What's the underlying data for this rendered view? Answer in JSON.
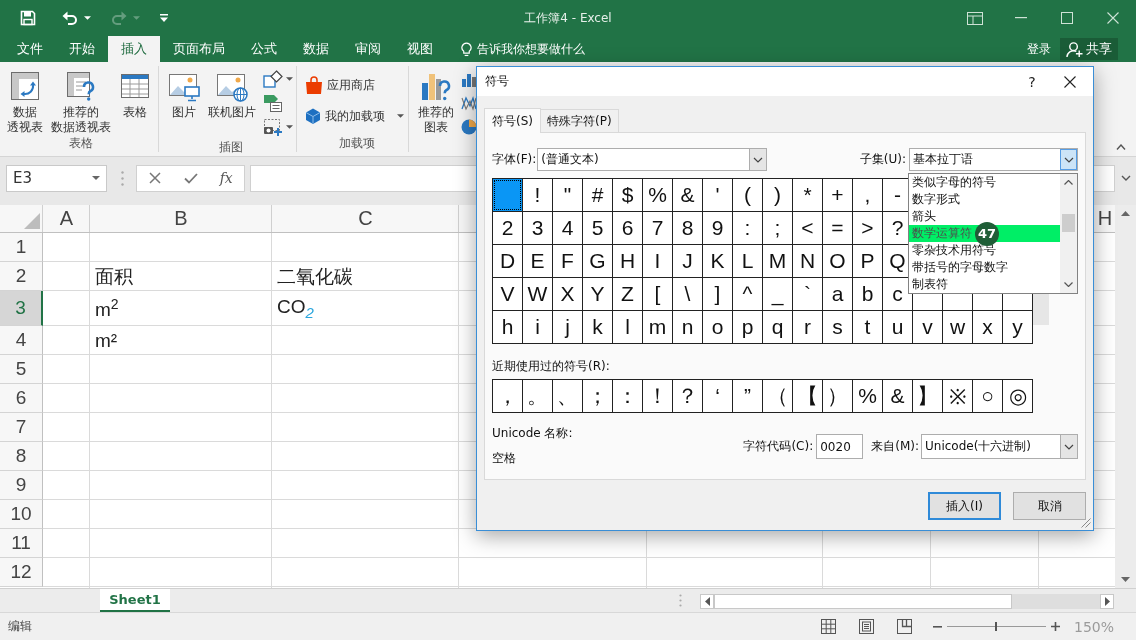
{
  "title_bar": {
    "title": "工作簿4 - Excel",
    "quick_access": [
      {
        "kind": "save",
        "disabled": false
      },
      {
        "kind": "undo",
        "disabled": false,
        "menu": true
      },
      {
        "kind": "redo",
        "disabled": true,
        "menu": true
      },
      {
        "kind": "customize",
        "disabled": false
      }
    ]
  },
  "menu": {
    "tabs": [
      {
        "label": "文件",
        "selected": false
      },
      {
        "label": "开始",
        "selected": false
      },
      {
        "label": "插入",
        "selected": true
      },
      {
        "label": "页面布局",
        "selected": false
      },
      {
        "label": "公式",
        "selected": false
      },
      {
        "label": "数据",
        "selected": false
      },
      {
        "label": "审阅",
        "selected": false
      },
      {
        "label": "视图",
        "selected": false
      }
    ],
    "tell_me": "告诉我你想要做什么",
    "sign_in": "登录",
    "share": "共享"
  },
  "ribbon": {
    "groups": [
      {
        "label": "表格",
        "large": [
          {
            "kind": "pivot_table",
            "lines": [
              "数据",
              "透视表"
            ]
          },
          {
            "kind": "recommended_pivot",
            "lines": [
              "推荐的",
              "数据透视表"
            ]
          },
          {
            "kind": "table",
            "lines": [
              "表格"
            ]
          }
        ]
      },
      {
        "label": "插图",
        "large": [
          {
            "kind": "picture",
            "lines": [
              "图片"
            ]
          },
          {
            "kind": "online_picture",
            "lines": [
              "联机图片"
            ]
          }
        ],
        "small": [
          {
            "kind": "shapes",
            "menu": true
          },
          {
            "kind": "smartart"
          },
          {
            "kind": "screenshot",
            "menu": true
          }
        ]
      },
      {
        "label": "加载项",
        "rows": [
          {
            "kind": "store",
            "label": "应用商店"
          },
          {
            "kind": "my_addins",
            "label": "我的加载项",
            "menu": true
          }
        ]
      },
      {
        "large": [
          {
            "kind": "recommended_chart",
            "lines": [
              "推荐的",
              "图表"
            ]
          }
        ],
        "small": [
          {
            "kind": "column_chart"
          },
          {
            "kind": "line_chart"
          },
          {
            "kind": "pie_chart"
          }
        ]
      }
    ]
  },
  "formula_bar": {
    "name_box": "E3",
    "function_button": "fx"
  },
  "sheet": {
    "columns": [
      "A",
      "B",
      "C",
      "H"
    ],
    "rows": [
      {
        "label": "1",
        "selected": false
      },
      {
        "label": "2",
        "selected": false,
        "column_b": "面积",
        "column_c": "二氧化碳"
      },
      {
        "label": "3",
        "selected": true,
        "column_b": "m$^{2}$",
        "column_c": "CO$_{2}$"
      },
      {
        "label": "4",
        "selected": false,
        "column_b": "m²"
      },
      {
        "label": "5",
        "selected": false
      },
      {
        "label": "6",
        "selected": false
      },
      {
        "label": "7",
        "selected": false
      },
      {
        "label": "8",
        "selected": false
      },
      {
        "label": "9",
        "selected": false
      },
      {
        "label": "10",
        "selected": false
      },
      {
        "label": "11",
        "selected": false
      },
      {
        "label": "12",
        "selected": false
      }
    ]
  },
  "sheet_tabs": [
    {
      "label": "Sheet1",
      "selected": true
    }
  ],
  "status_bar": {
    "mode": "编辑",
    "zoom": "150%",
    "zoom_slider": {
      "level": 0.5
    }
  },
  "dialog": {
    "title": "符号",
    "help": "?",
    "tabs": [
      {
        "label": "符号(S)",
        "selected": true
      },
      {
        "label": "特殊字符(P)",
        "selected": false
      }
    ],
    "font": {
      "label": "字体(F):",
      "value": "(普通文本)"
    },
    "subset": {
      "label": "子集(U):",
      "value": "基本拉丁语",
      "expanded": true,
      "options": [
        {
          "label": "类似字母的符号",
          "selected": false
        },
        {
          "label": "数字形式",
          "selected": false
        },
        {
          "label": "箭头",
          "selected": false
        },
        {
          "label": "数学运算符",
          "selected": true
        },
        {
          "label": "零杂技术用符号",
          "selected": false
        },
        {
          "label": "带括号的字母数字",
          "selected": false
        },
        {
          "label": "制表符",
          "selected": false
        }
      ]
    },
    "symbols": [
      [
        {
          "selected": true
        },
        {
          "char": "!",
          "selected": false
        },
        {
          "char": "\"",
          "selected": false
        },
        {
          "char": "#",
          "selected": false
        },
        {
          "char": "$",
          "selected": false
        },
        {
          "char": "%",
          "selected": false
        },
        {
          "char": "&",
          "selected": false
        },
        {
          "char": "'",
          "selected": false
        },
        {
          "char": "(",
          "selected": false
        },
        {
          "char": ")",
          "selected": false
        },
        {
          "char": "*",
          "selected": false
        },
        {
          "char": "+",
          "selected": false
        },
        {
          "char": ",",
          "selected": false
        },
        {
          "char": "-",
          "selected": false
        }
      ],
      [
        {
          "char": "2",
          "selected": false
        },
        {
          "char": "3",
          "selected": false
        },
        {
          "char": "4",
          "selected": false
        },
        {
          "char": "5",
          "selected": false
        },
        {
          "char": "6",
          "selected": false
        },
        {
          "char": "7",
          "selected": false
        },
        {
          "char": "8",
          "selected": false
        },
        {
          "char": "9",
          "selected": false
        },
        {
          "char": ":",
          "selected": false
        },
        {
          "char": ";",
          "selected": false
        },
        {
          "char": "<",
          "selected": false
        },
        {
          "char": "=",
          "selected": false
        },
        {
          "char": ">",
          "selected": false
        },
        {
          "char": "?",
          "selected": false
        }
      ],
      [
        {
          "char": "D",
          "selected": false
        },
        {
          "char": "E",
          "selected": false
        },
        {
          "char": "F",
          "selected": false
        },
        {
          "char": "G",
          "selected": false
        },
        {
          "char": "H",
          "selected": false
        },
        {
          "char": "I",
          "selected": false
        },
        {
          "char": "J",
          "selected": false
        },
        {
          "char": "K",
          "selected": false
        },
        {
          "char": "L",
          "selected": false
        },
        {
          "char": "M",
          "selected": false
        },
        {
          "char": "N",
          "selected": false
        },
        {
          "char": "O",
          "selected": false
        },
        {
          "char": "P",
          "selected": false
        },
        {
          "char": "Q",
          "selected": false
        }
      ],
      [
        {
          "char": "V",
          "selected": false
        },
        {
          "char": "W",
          "selected": false
        },
        {
          "char": "X",
          "selected": false
        },
        {
          "char": "Y",
          "selected": false
        },
        {
          "char": "Z",
          "selected": false
        },
        {
          "char": "[",
          "selected": false
        },
        {
          "char": "\\",
          "selected": false
        },
        {
          "char": "]",
          "selected": false
        },
        {
          "char": "^",
          "selected": false
        },
        {
          "char": "_",
          "selected": false
        },
        {
          "char": "`",
          "selected": false
        },
        {
          "char": "a",
          "selected": false
        },
        {
          "char": "b",
          "selected": false
        },
        {
          "char": "c",
          "selected": false
        }
      ],
      [
        {
          "char": "h",
          "selected": false
        },
        {
          "char": "i",
          "selected": false
        },
        {
          "char": "j",
          "selected": false
        },
        {
          "char": "k",
          "selected": false
        },
        {
          "char": "l",
          "selected": false
        },
        {
          "char": "m",
          "selected": false
        },
        {
          "char": "n",
          "selected": false
        },
        {
          "char": "o",
          "selected": false
        },
        {
          "char": "p",
          "selected": false
        },
        {
          "char": "q",
          "selected": false
        },
        {
          "char": "r",
          "selected": false
        },
        {
          "char": "s",
          "selected": false
        },
        {
          "char": "t",
          "selected": false
        },
        {
          "char": "u",
          "selected": false
        },
        {
          "char": "v",
          "selected": false
        },
        {
          "char": "w",
          "selected": false
        },
        {
          "char": "x",
          "selected": false
        },
        {
          "char": "y",
          "selected": false
        }
      ]
    ],
    "recent_label": "近期使用过的符号(R):",
    "recent": [
      {
        "char": "，",
        "selected": false
      },
      {
        "char": "。",
        "selected": false
      },
      {
        "char": "、",
        "selected": false
      },
      {
        "char": "；",
        "selected": false
      },
      {
        "char": "：",
        "selected": false
      },
      {
        "char": "！",
        "selected": false
      },
      {
        "char": "？",
        "selected": false
      },
      {
        "char": "‘",
        "selected": false
      },
      {
        "char": "”",
        "selected": false
      },
      {
        "char": "（",
        "selected": false
      },
      {
        "char": "【",
        "selected": false
      },
      {
        "char": "）",
        "selected": false
      },
      {
        "char": "%",
        "selected": false
      },
      {
        "char": "&",
        "selected": false
      },
      {
        "char": "】",
        "selected": false
      },
      {
        "char": "※",
        "selected": false
      },
      {
        "char": "○",
        "selected": false
      },
      {
        "char": "◎",
        "selected": false
      }
    ],
    "unicode_name_label": "Unicode 名称:",
    "unicode_name": "空格",
    "char_code": {
      "label": "字符代码(C):",
      "value": "0020"
    },
    "from": {
      "label": "来自(M):",
      "value": "Unicode(十六进制)"
    },
    "buttons": [
      {
        "label": "插入(I)",
        "kind": "default"
      },
      {
        "label": "取消",
        "kind": "normal"
      }
    ],
    "step_badge": "47"
  }
}
